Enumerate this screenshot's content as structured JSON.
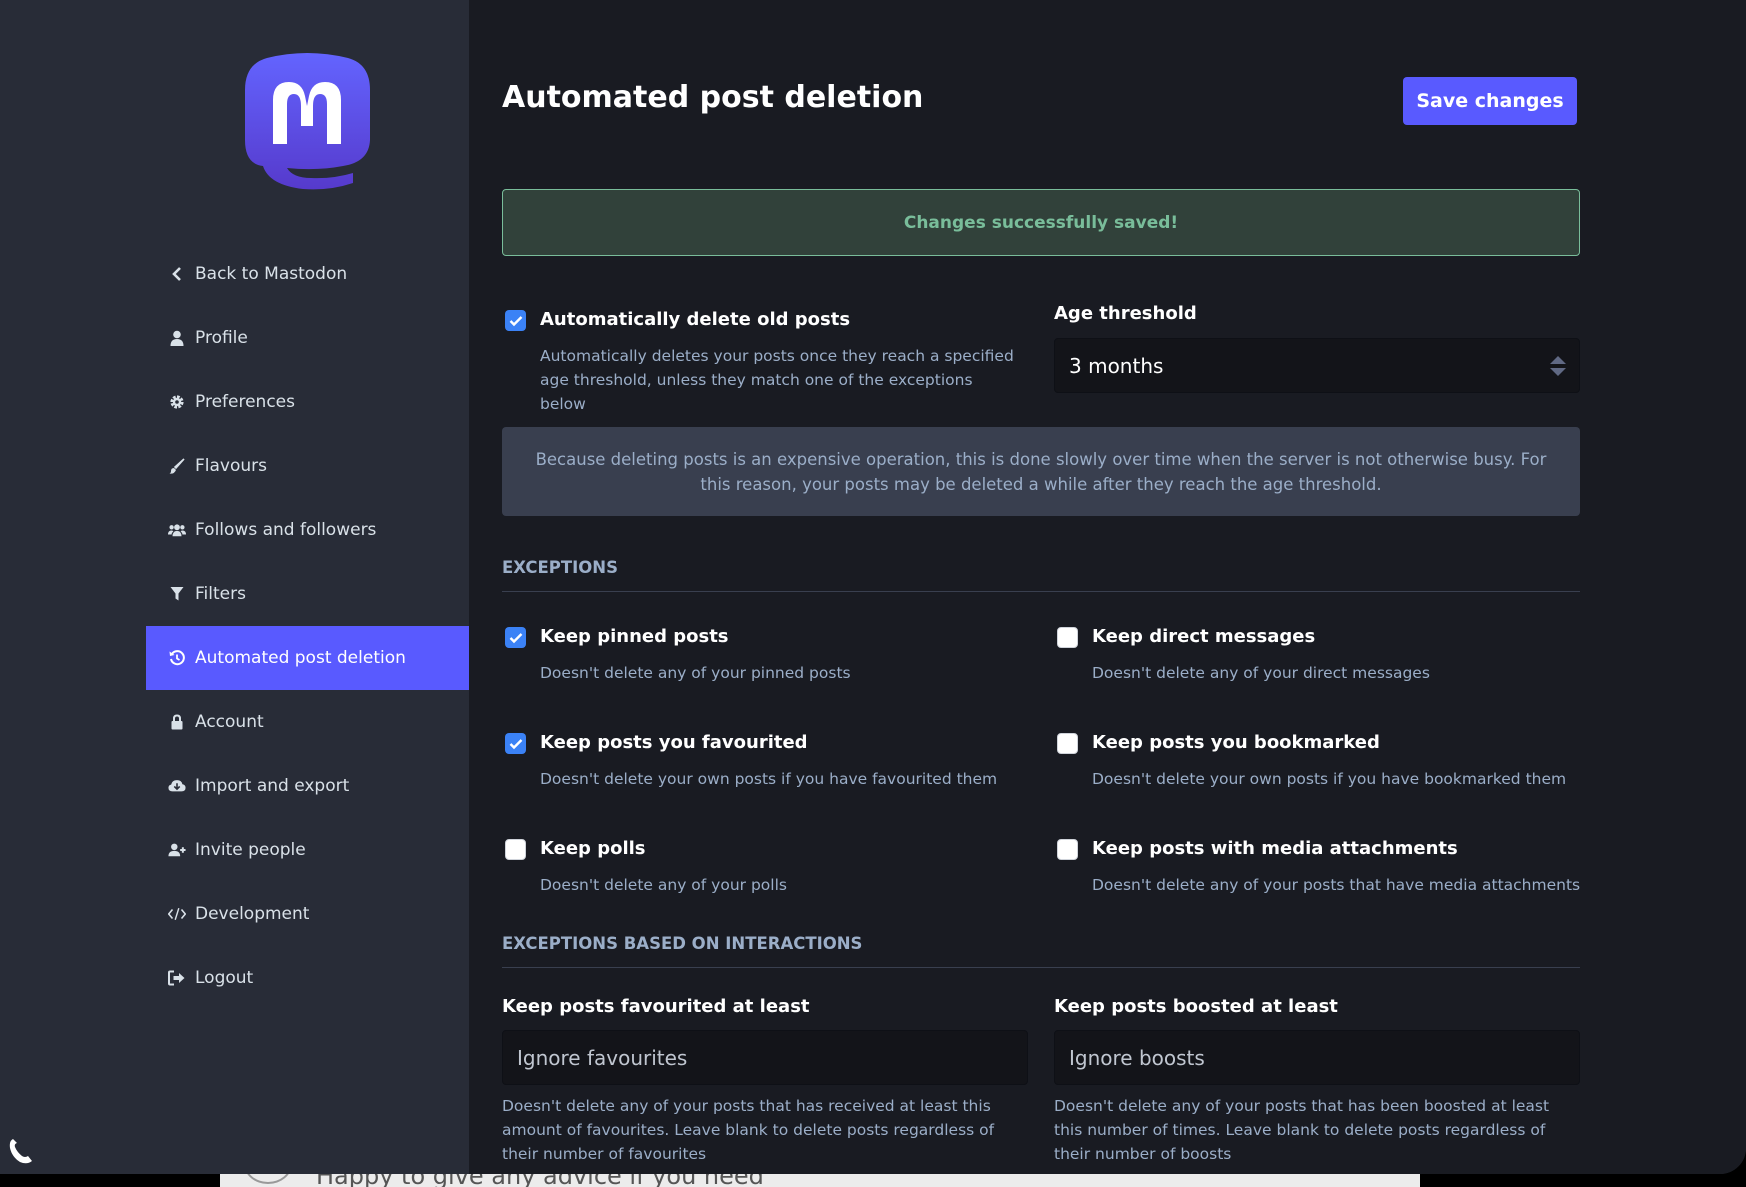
{
  "sidebar": {
    "items": [
      {
        "label": "Back to Mastodon",
        "icon": "chevron-left-icon"
      },
      {
        "label": "Profile",
        "icon": "user-icon"
      },
      {
        "label": "Preferences",
        "icon": "gear-icon"
      },
      {
        "label": "Flavours",
        "icon": "paintbrush-icon"
      },
      {
        "label": "Follows and followers",
        "icon": "users-icon"
      },
      {
        "label": "Filters",
        "icon": "filter-icon"
      },
      {
        "label": "Automated post deletion",
        "icon": "history-icon",
        "active": true
      },
      {
        "label": "Account",
        "icon": "lock-icon"
      },
      {
        "label": "Import and export",
        "icon": "cloud-download-icon"
      },
      {
        "label": "Invite people",
        "icon": "user-plus-icon"
      },
      {
        "label": "Development",
        "icon": "code-icon"
      },
      {
        "label": "Logout",
        "icon": "sign-out-icon"
      }
    ]
  },
  "header": {
    "title": "Automated post deletion",
    "save_label": "Save changes"
  },
  "flash": "Changes successfully saved!",
  "auto_delete": {
    "label": "Automatically delete old posts",
    "hint": "Automatically deletes your posts once they reach a specified age threshold, unless they match one of the exceptions below",
    "checked": true
  },
  "age_threshold": {
    "label": "Age threshold",
    "value": "3 months"
  },
  "info": "Because deleting posts is an expensive operation, this is done slowly over time when the server is not otherwise busy. For this reason, your posts may be deleted a while after they reach the age threshold.",
  "exceptions": {
    "heading": "EXCEPTIONS",
    "options": [
      {
        "label": "Keep pinned posts",
        "hint": "Doesn't delete any of your pinned posts",
        "checked": true
      },
      {
        "label": "Keep direct messages",
        "hint": "Doesn't delete any of your direct messages",
        "checked": false
      },
      {
        "label": "Keep posts you favourited",
        "hint": "Doesn't delete your own posts if you have favourited them",
        "checked": true
      },
      {
        "label": "Keep posts you bookmarked",
        "hint": "Doesn't delete your own posts if you have bookmarked them",
        "checked": false
      },
      {
        "label": "Keep polls",
        "hint": "Doesn't delete any of your polls",
        "checked": false
      },
      {
        "label": "Keep posts with media attachments",
        "hint": "Doesn't delete any of your posts that have media attachments",
        "checked": false
      }
    ]
  },
  "interactions": {
    "heading": "EXCEPTIONS BASED ON INTERACTIONS",
    "favourites": {
      "label": "Keep posts favourited at least",
      "placeholder": "Ignore favourites",
      "hint": "Doesn't delete any of your posts that has received at least this amount of favourites. Leave blank to delete posts regardless of their number of favourites"
    },
    "boosts": {
      "label": "Keep posts boosted at least",
      "placeholder": "Ignore boosts",
      "hint": "Doesn't delete any of your posts that has been boosted at least this number of times. Leave blank to delete posts regardless of their number of boosts"
    }
  },
  "background_window": {
    "text": "Happy to give any advice if you need"
  },
  "colors": {
    "accent": "#595aff",
    "success": "#79bd9a",
    "checkbox": "#3b82f6"
  }
}
